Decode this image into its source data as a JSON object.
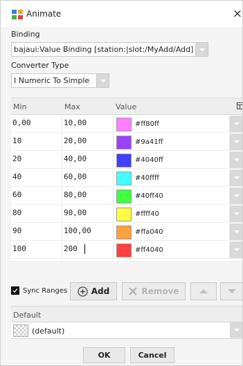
{
  "window": {
    "title": "Animate",
    "close_glyph": "×"
  },
  "binding": {
    "label": "Binding",
    "value": "bajaui:Value Binding [station:|slot:/MyAdd/Add]"
  },
  "converter": {
    "label": "Converter Type",
    "value": "I Numeric To Simple"
  },
  "table": {
    "headers": {
      "min": "Min",
      "max": "Max",
      "value": "Value"
    },
    "rows": [
      {
        "min": "0,00",
        "max": "10,00",
        "hex": "#ff80ff",
        "color": "#ff80ff"
      },
      {
        "min": "10",
        "max": "20,00",
        "hex": "#9a41ff",
        "color": "#9a41ff"
      },
      {
        "min": "20",
        "max": "40,00",
        "hex": "#4040ff",
        "color": "#4040ff"
      },
      {
        "min": "40",
        "max": "60,00",
        "hex": "#40ffff",
        "color": "#40ffff"
      },
      {
        "min": "60",
        "max": "80,00",
        "hex": "#40ff40",
        "color": "#40ff40"
      },
      {
        "min": "80",
        "max": "90,00",
        "hex": "#ffff40",
        "color": "#ffff40"
      },
      {
        "min": "90",
        "max": "100,00",
        "hex": "#ffa040",
        "color": "#ffa040"
      },
      {
        "min": "100",
        "max": "200",
        "hex": "#ff4040",
        "color": "#ff4040"
      }
    ]
  },
  "toolbar": {
    "sync_ranges_label": "Sync Ranges",
    "sync_ranges_checked": true,
    "add_label": "Add",
    "remove_label": "Remove"
  },
  "default": {
    "header": "Default",
    "value": "(default)"
  },
  "buttons": {
    "ok": "OK",
    "cancel": "Cancel"
  },
  "icons": {
    "title": "animate-icon",
    "close": "close-icon",
    "dropdown": "chevron-down-icon",
    "add": "plus-circle-icon",
    "remove": "x-icon",
    "up": "arrow-up-icon",
    "down": "arrow-down-icon",
    "column_chooser": "column-chooser-icon"
  },
  "colors": {
    "accent": "#4a90d9",
    "dropdown_button": "#d8d8d8"
  }
}
